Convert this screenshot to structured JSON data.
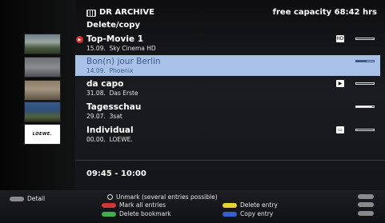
{
  "header": {
    "app_title": "DR ARCHIVE",
    "subtitle": "Delete/copy",
    "capacity": "free capacity 68:42 hrs"
  },
  "entries": [
    {
      "title": "Top-Movie 1",
      "date": "15.09.",
      "channel": "Sky Cinema HD",
      "recording_badge": "▶",
      "icon": "HD",
      "progress": 0.0
    },
    {
      "title": "Bon(n) jour Berlin",
      "date": "14.09.",
      "channel": "Phoenix",
      "selected": true,
      "progress": 0.6
    },
    {
      "title": "da capo",
      "date": "31.08.",
      "channel": "Das Erste",
      "icon": "▶",
      "progress": 0.0
    },
    {
      "title": "Tagesschau",
      "date": "29.07.",
      "channel": "3sat",
      "progress": 0.9
    },
    {
      "title": "Individual",
      "date": "00.00.",
      "channel": "LOEWE.",
      "icon": "▭",
      "progress": 0.0
    }
  ],
  "thumbnail_logo": "LOEWE.",
  "time_range": "09:45 - 10:00",
  "footer": {
    "detail": "Detail",
    "unmark": "Unmark (several entries possible)",
    "mark_all": "Mark all entries",
    "delete_bookmark": "Delete bookmark",
    "delete_entry": "Delete entry",
    "copy_entry": "Copy entry"
  },
  "colors": {
    "selection": "#a9c1e6",
    "selection_text": "#3b5a8c",
    "red": "#d23535",
    "green": "#3fb04a",
    "yellow": "#e7d234",
    "blue": "#3560d0"
  }
}
